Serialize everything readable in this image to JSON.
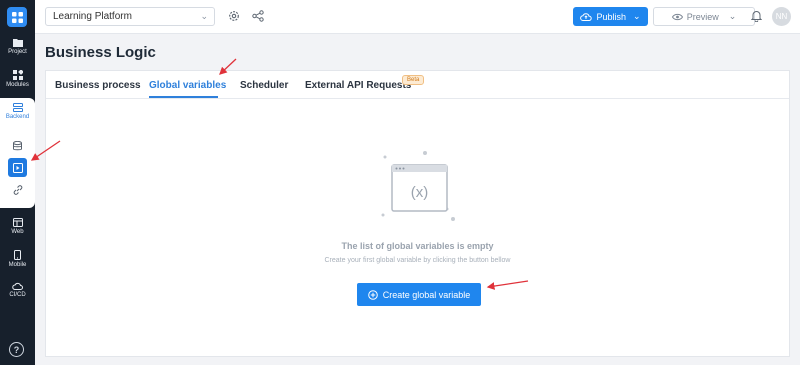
{
  "header": {
    "project_name": "Learning Platform",
    "publish_label": "Publish",
    "preview_label": "Preview",
    "avatar_initials": "NN"
  },
  "sidebar": {
    "items": [
      {
        "label": "Project",
        "icon": "folder-icon"
      },
      {
        "label": "Modules",
        "icon": "modules-icon"
      },
      {
        "label": "Backend",
        "icon": "server-icon"
      },
      {
        "label": "Web",
        "icon": "web-icon"
      },
      {
        "label": "Mobile",
        "icon": "mobile-icon"
      },
      {
        "label": "CI/CD",
        "icon": "cloud-icon"
      }
    ],
    "help_label": "?"
  },
  "page": {
    "title": "Business Logic",
    "tabs": [
      {
        "label": "Business process"
      },
      {
        "label": "Global variables"
      },
      {
        "label": "Scheduler"
      },
      {
        "label": "External API Requests"
      }
    ],
    "beta_badge": "Beta",
    "active_tab": "Global variables"
  },
  "empty_state": {
    "illustration_text": "(x)",
    "title": "The list of global variables is empty",
    "subtitle": "Create your first global variable by clicking the button bellow",
    "button_label": "Create global variable"
  },
  "colors": {
    "accent": "#1f86ee",
    "sidebar_bg": "#17202c",
    "annotation_arrow": "#e0323a",
    "beta_bg": "#fdebd3"
  }
}
